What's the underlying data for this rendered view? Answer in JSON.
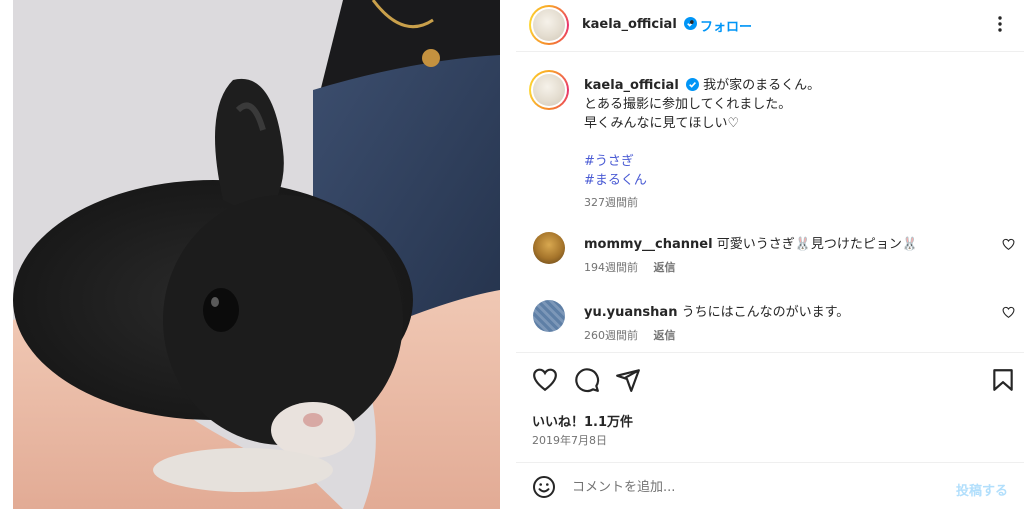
{
  "post": {
    "username": "kaela_official",
    "follow_label": "フォロー",
    "dot": "•",
    "image_alt": "black rabbit held in arms"
  },
  "caption": {
    "username": "kaela_official",
    "line1": "我が家のまるくん。",
    "line2": "とある撮影に参加してくれました。",
    "line3": "早くみんなに見てほしい♡",
    "hashtags": [
      "#うさぎ",
      "#まるくん"
    ],
    "time": "327週間前"
  },
  "comments": [
    {
      "username": "mommy__channel",
      "text": "可愛いうさぎ🐰見つけたピョン🐰",
      "time": "194週間前",
      "reply_label": "返信"
    },
    {
      "username": "yu.yuanshan",
      "text": "うちにはこんなのがいます。",
      "time": "260週間前",
      "reply_label": "返信"
    }
  ],
  "actions": {
    "likes": "いいね！1.1万件",
    "date": "2019年7月8日"
  },
  "add_comment": {
    "placeholder": "コメントを追加...",
    "post_label": "投稿する"
  },
  "colors": {
    "accent": "#0095f6",
    "hashtag": "#4a5bd4",
    "muted": "#737373",
    "post_disabled": "#b2dffc"
  },
  "icons": [
    "verified-badge-icon",
    "more-options-icon",
    "heart-icon",
    "comment-icon",
    "share-icon",
    "bookmark-icon",
    "emoji-icon"
  ]
}
